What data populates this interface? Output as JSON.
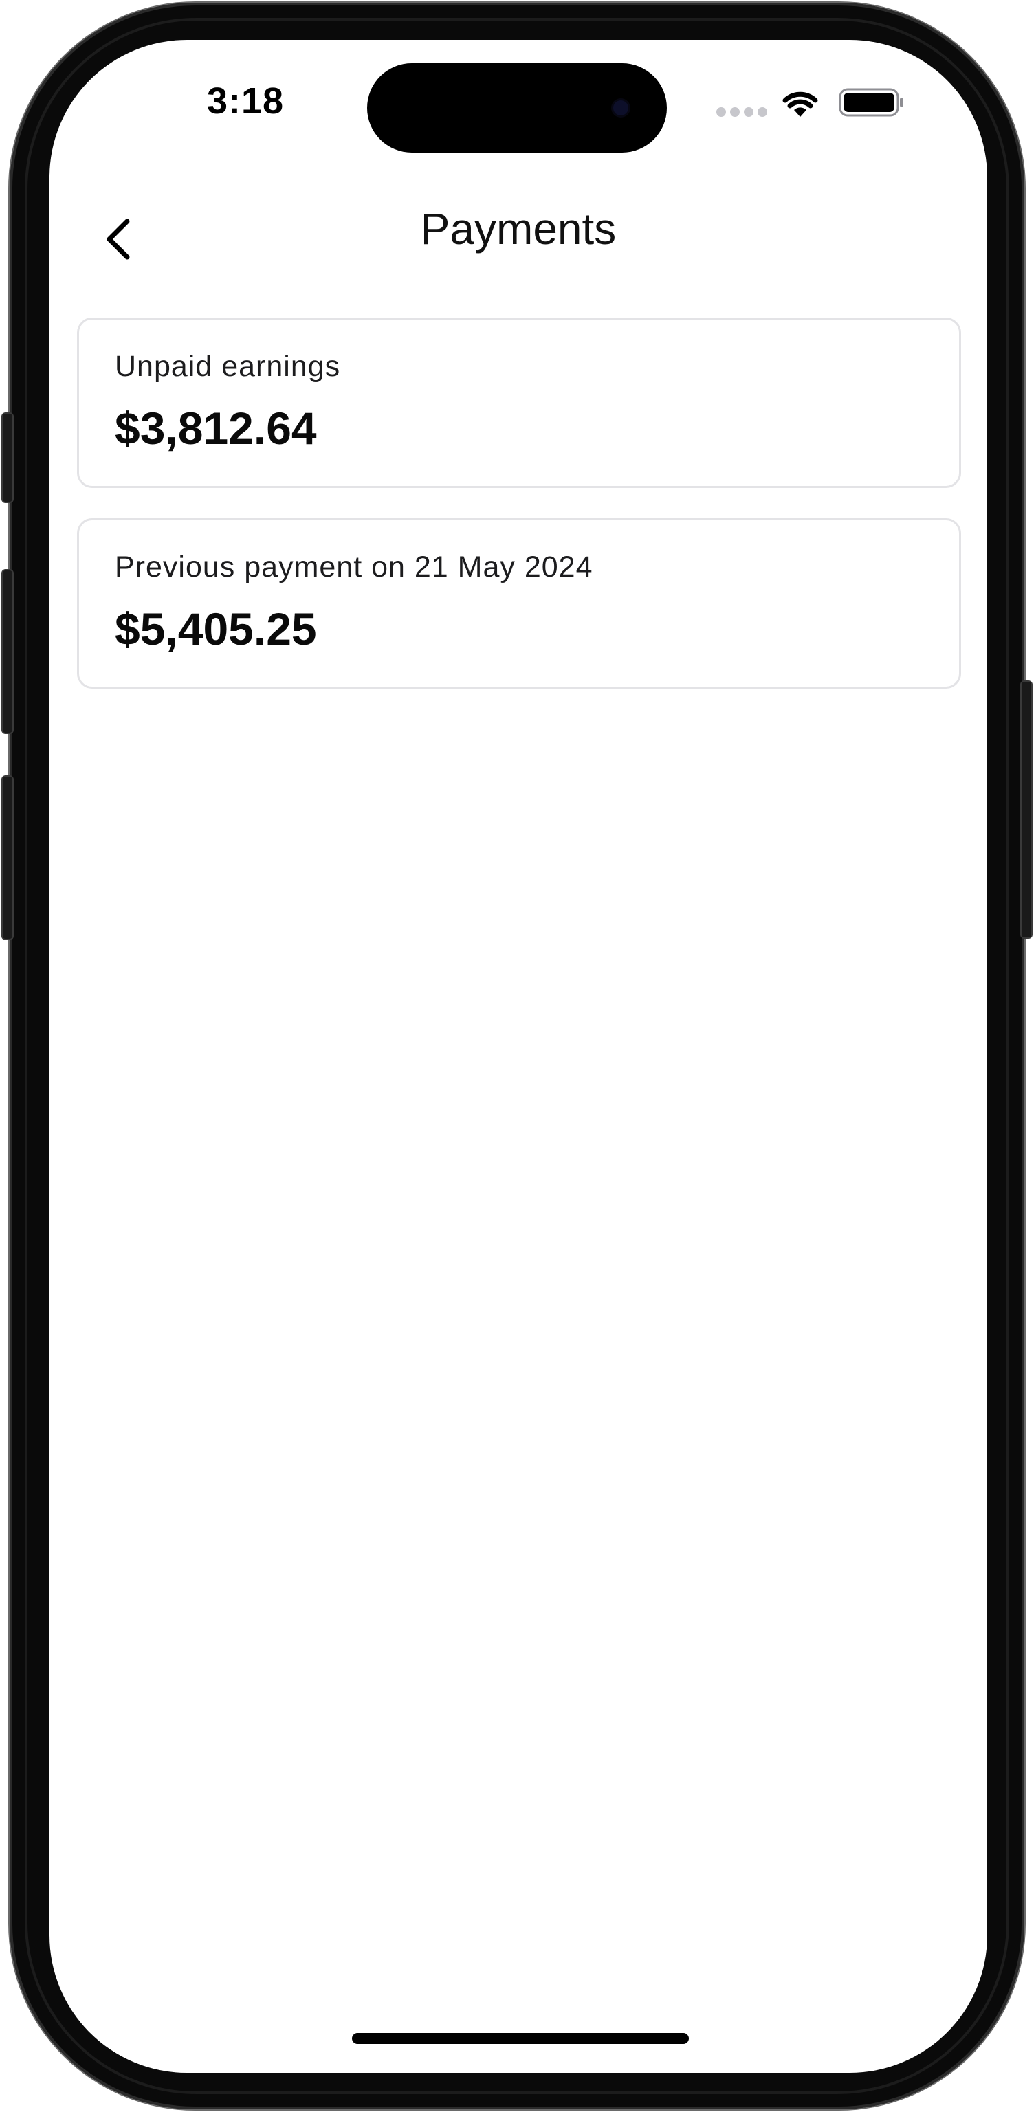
{
  "status_bar": {
    "time": "3:18",
    "wifi_icon": "wifi-icon",
    "battery_icon": "battery-icon",
    "signal_icon": "cellular-signal-icon"
  },
  "nav": {
    "title": "Payments",
    "back_icon": "chevron-left-icon"
  },
  "cards": [
    {
      "label": "Unpaid earnings",
      "value": "$3,812.64"
    },
    {
      "label": "Previous payment on 21 May 2024",
      "value": "$5,405.25"
    }
  ],
  "colors": {
    "background": "#ffffff",
    "text_primary": "#0a0a0a",
    "card_border": "#e3e3e6",
    "frame": "#0a0a0a"
  }
}
